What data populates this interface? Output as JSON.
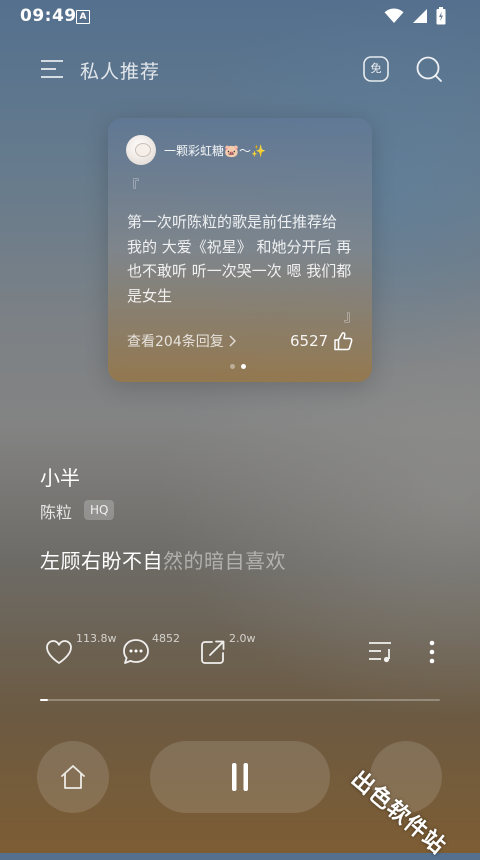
{
  "status_bar": {
    "time": "09:49",
    "notification_letter": "A"
  },
  "header": {
    "title": "私人推荐",
    "free_badge": "免"
  },
  "comment_card": {
    "username": "一颗彩虹糖🐷～✨",
    "quote_open": "『",
    "quote_close": "』",
    "text": "第一次听陈粒的歌是前任推荐给\n我的 大爱《祝星》 和她分开后 再\n也不敢听 听一次哭一次 嗯 我们都\n是女生",
    "replies_label": "查看204条回复",
    "likes": "6527",
    "page_dots": {
      "count": 2,
      "active_index": 1
    }
  },
  "song": {
    "title": "小半",
    "artist": "陈粒",
    "quality_badge": "HQ",
    "lyric_sung": "左顾右盼不自",
    "lyric_rest": "然的暗自喜欢"
  },
  "actions": {
    "like_count": "113.8w",
    "comment_count": "4852",
    "share_count": "2.0w"
  },
  "progress": {
    "fraction": 0.02
  },
  "watermark": "出色软件站",
  "colors": {
    "accent": "#ffffff"
  },
  "icons": [
    "menu-icon",
    "free-icon",
    "search-icon",
    "heart-icon",
    "comment-icon",
    "share-icon",
    "playlist-icon",
    "more-icon",
    "home-icon",
    "pause-icon",
    "thumb-up-icon",
    "chevron-right-icon"
  ]
}
